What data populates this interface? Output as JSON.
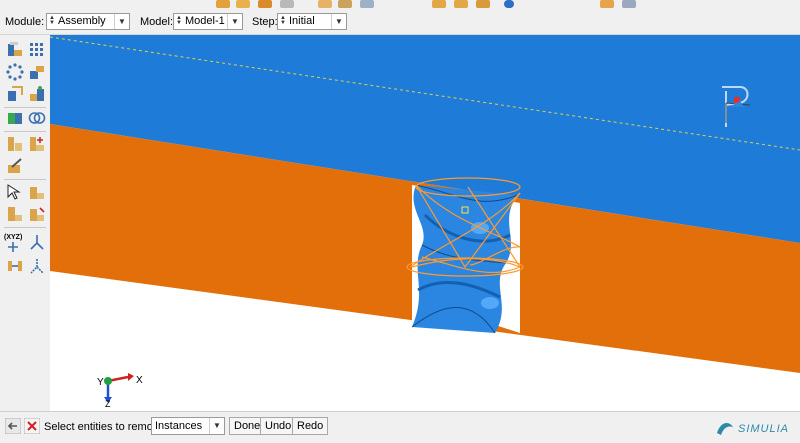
{
  "context_bar": {
    "module_label": "Module:",
    "module_value": "Assembly",
    "model_label": "Model:",
    "model_value": "Model-1",
    "step_label": "Step:",
    "step_value": "Initial"
  },
  "toolbox": {
    "xyz_label": "(XYZ)"
  },
  "viewport": {
    "triad": {
      "x_label": "X",
      "y_label": "Y",
      "z_label": "Z"
    },
    "colors": {
      "blue": "#1e7bd8",
      "orange": "#e36f0a",
      "edge": "#ff9a2e"
    }
  },
  "prompt": {
    "text": "Select entities to remove:",
    "dropdown_value": "Instances",
    "done_label": "Done",
    "undo_label": "Undo",
    "redo_label": "Redo"
  },
  "brand": {
    "logo_text": "SIMULIA"
  }
}
